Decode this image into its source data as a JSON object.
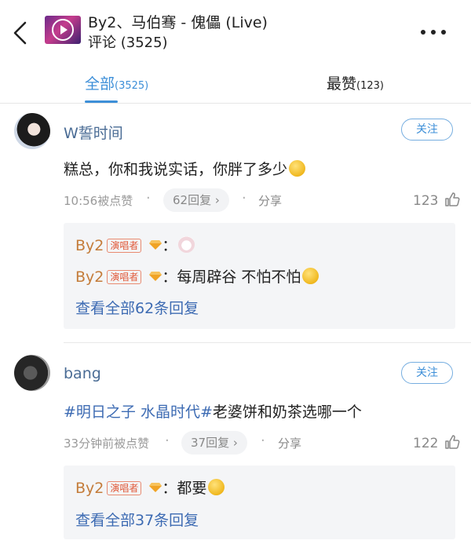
{
  "header": {
    "title": "By2、马伯骞 - 傀儡 (Live)",
    "subtitle": "评论 (3525)",
    "back_icon": "chevron-left-icon",
    "more_icon": "more-icon"
  },
  "tabs": [
    {
      "label": "全部",
      "count": "(3525)",
      "active": true
    },
    {
      "label": "最赞",
      "count": "(123)",
      "active": false
    }
  ],
  "comments": [
    {
      "username": "W誓时间",
      "follow_label": "关注",
      "content": "糕总，你和我说实话，你胖了多少",
      "time": "10:56被点赞",
      "reply_count_label": "62回复 ›",
      "share_label": "分享",
      "likes": "123",
      "replies": [
        {
          "name": "By2",
          "badge": "演唱者",
          "text": "："
        },
        {
          "name": "By2",
          "badge": "演唱者",
          "text": "：每周辟谷 不怕不怕"
        }
      ],
      "view_all": "查看全部62条回复"
    },
    {
      "username": "bang",
      "follow_label": "关注",
      "content_topic": "#明日之子 水晶时代#",
      "content_rest": "老婆饼和奶茶选哪一个",
      "time": "33分钟前被点赞",
      "reply_count_label": "37回复 ›",
      "share_label": "分享",
      "likes": "122",
      "replies": [
        {
          "name": "By2",
          "badge": "演唱者",
          "text": "：都要"
        }
      ],
      "view_all": "查看全部37条回复"
    }
  ],
  "colors": {
    "accent": "#3d8fd8",
    "username": "#4a6c95",
    "reply_name": "#c47c3a",
    "badge": "#e05a3a",
    "link": "#3d6bb3"
  }
}
